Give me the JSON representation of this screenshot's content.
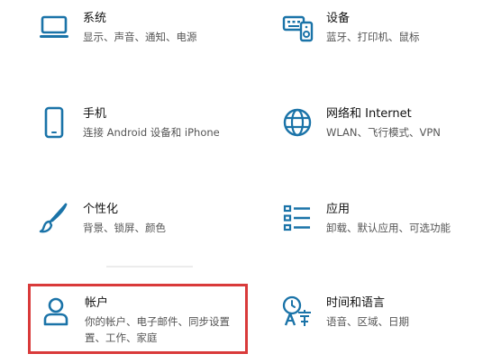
{
  "settings": {
    "left": [
      {
        "key": "system",
        "title": "系统",
        "desc": "显示、声音、通知、电源",
        "icon": "monitor-icon"
      },
      {
        "key": "phone",
        "title": "手机",
        "desc": "连接 Android 设备和 iPhone",
        "icon": "phone-icon"
      },
      {
        "key": "personalization",
        "title": "个性化",
        "desc": "背景、锁屏、颜色",
        "icon": "brush-icon"
      },
      {
        "key": "accounts",
        "title": "帐户",
        "desc": "你的帐户、电子邮件、同步设置",
        "desc2": "置、工作、家庭",
        "icon": "person-icon"
      }
    ],
    "right": [
      {
        "key": "devices",
        "title": "设备",
        "desc": "蓝牙、打印机、鼠标",
        "icon": "keyboard-speaker-icon"
      },
      {
        "key": "network",
        "title": "网络和 Internet",
        "desc": "WLAN、飞行模式、VPN",
        "icon": "globe-icon"
      },
      {
        "key": "apps",
        "title": "应用",
        "desc": "卸载、默认应用、可选功能",
        "icon": "list-icon"
      },
      {
        "key": "time-language",
        "title": "时间和语言",
        "desc": "语音、区域、日期",
        "icon": "language-icon"
      }
    ]
  },
  "colors": {
    "icon_accent": "#1a73a8",
    "highlight_border": "#d93a3a"
  }
}
